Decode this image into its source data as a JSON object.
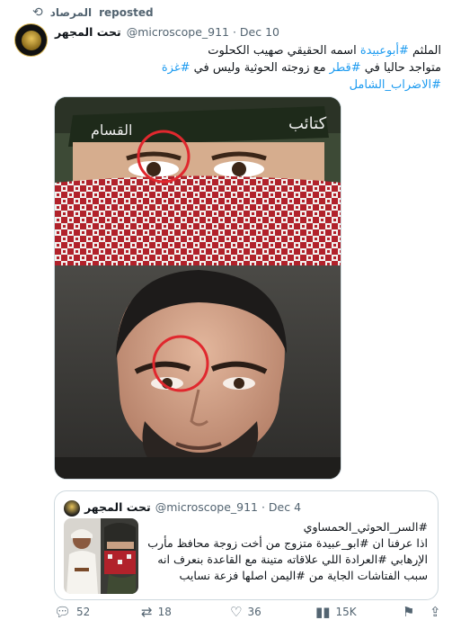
{
  "repost": {
    "reposter": "المرصاد",
    "label": "reposted"
  },
  "post": {
    "author_name": "تحت المجهر",
    "handle_date": "@microscope_911 · Dec 10",
    "text_lines": [
      [
        {
          "t": "الملثم "
        },
        {
          "t": "#أبوعبيدة",
          "h": true
        },
        {
          "t": " اسمه الحقيقي صهيب الكحلوت"
        }
      ],
      [
        {
          "t": "متواجد حاليا في "
        },
        {
          "t": "#قطر",
          "h": true
        },
        {
          "t": " مع زوجته الحوثية وليس في "
        },
        {
          "t": "#غزة",
          "h": true
        }
      ],
      [
        {
          "t": "#الاضراب_الشامل",
          "h": true
        }
      ]
    ]
  },
  "quote": {
    "author_name": "تحت المجهر",
    "handle_date": "@microscope_911 · Dec 4",
    "text_lines": [
      "#السر_الحوثي_الحمساوي",
      "اذا عرفنا ان #ابو_عبيدة متزوج من أخت زوجة محافظ مأرب",
      "الإرهابي #العرادة اللي علاقاته متينة مع القاعدة بنعرف انه",
      "سبب الفتاشات الجاية من #اليمن اصلها فزعة نسايب"
    ]
  },
  "actions": {
    "replies": "52",
    "reposts": "18",
    "likes": "36",
    "views": "15K"
  },
  "icons": {
    "repost": "repost-icon",
    "reply": "reply-icon",
    "retweet": "retweet-icon",
    "like": "heart-icon",
    "views": "views-chart-icon",
    "bookmark": "bookmark-icon",
    "share": "share-icon"
  },
  "colors": {
    "accent": "#1d9bf0",
    "text": "#0f1419",
    "muted": "#536471",
    "border": "#cfd9de",
    "highlight_circle": "#e0282e"
  }
}
